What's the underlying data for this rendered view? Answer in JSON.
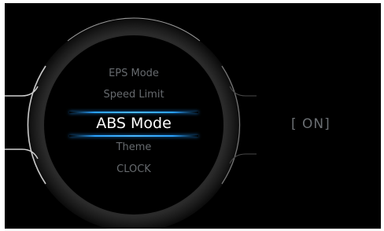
{
  "menu": {
    "items": [
      {
        "label": "EPS Mode"
      },
      {
        "label": "Speed Limit"
      },
      {
        "label": "ABS Mode"
      },
      {
        "label": "Theme"
      },
      {
        "label": "CLOCK"
      }
    ],
    "selected_index": 2
  },
  "value_display": "[ ON]",
  "colors": {
    "background": "#000000",
    "selection_accent": "#2aa2ff",
    "selected_text": "#ffffff",
    "dim_text": "#666a6e"
  }
}
